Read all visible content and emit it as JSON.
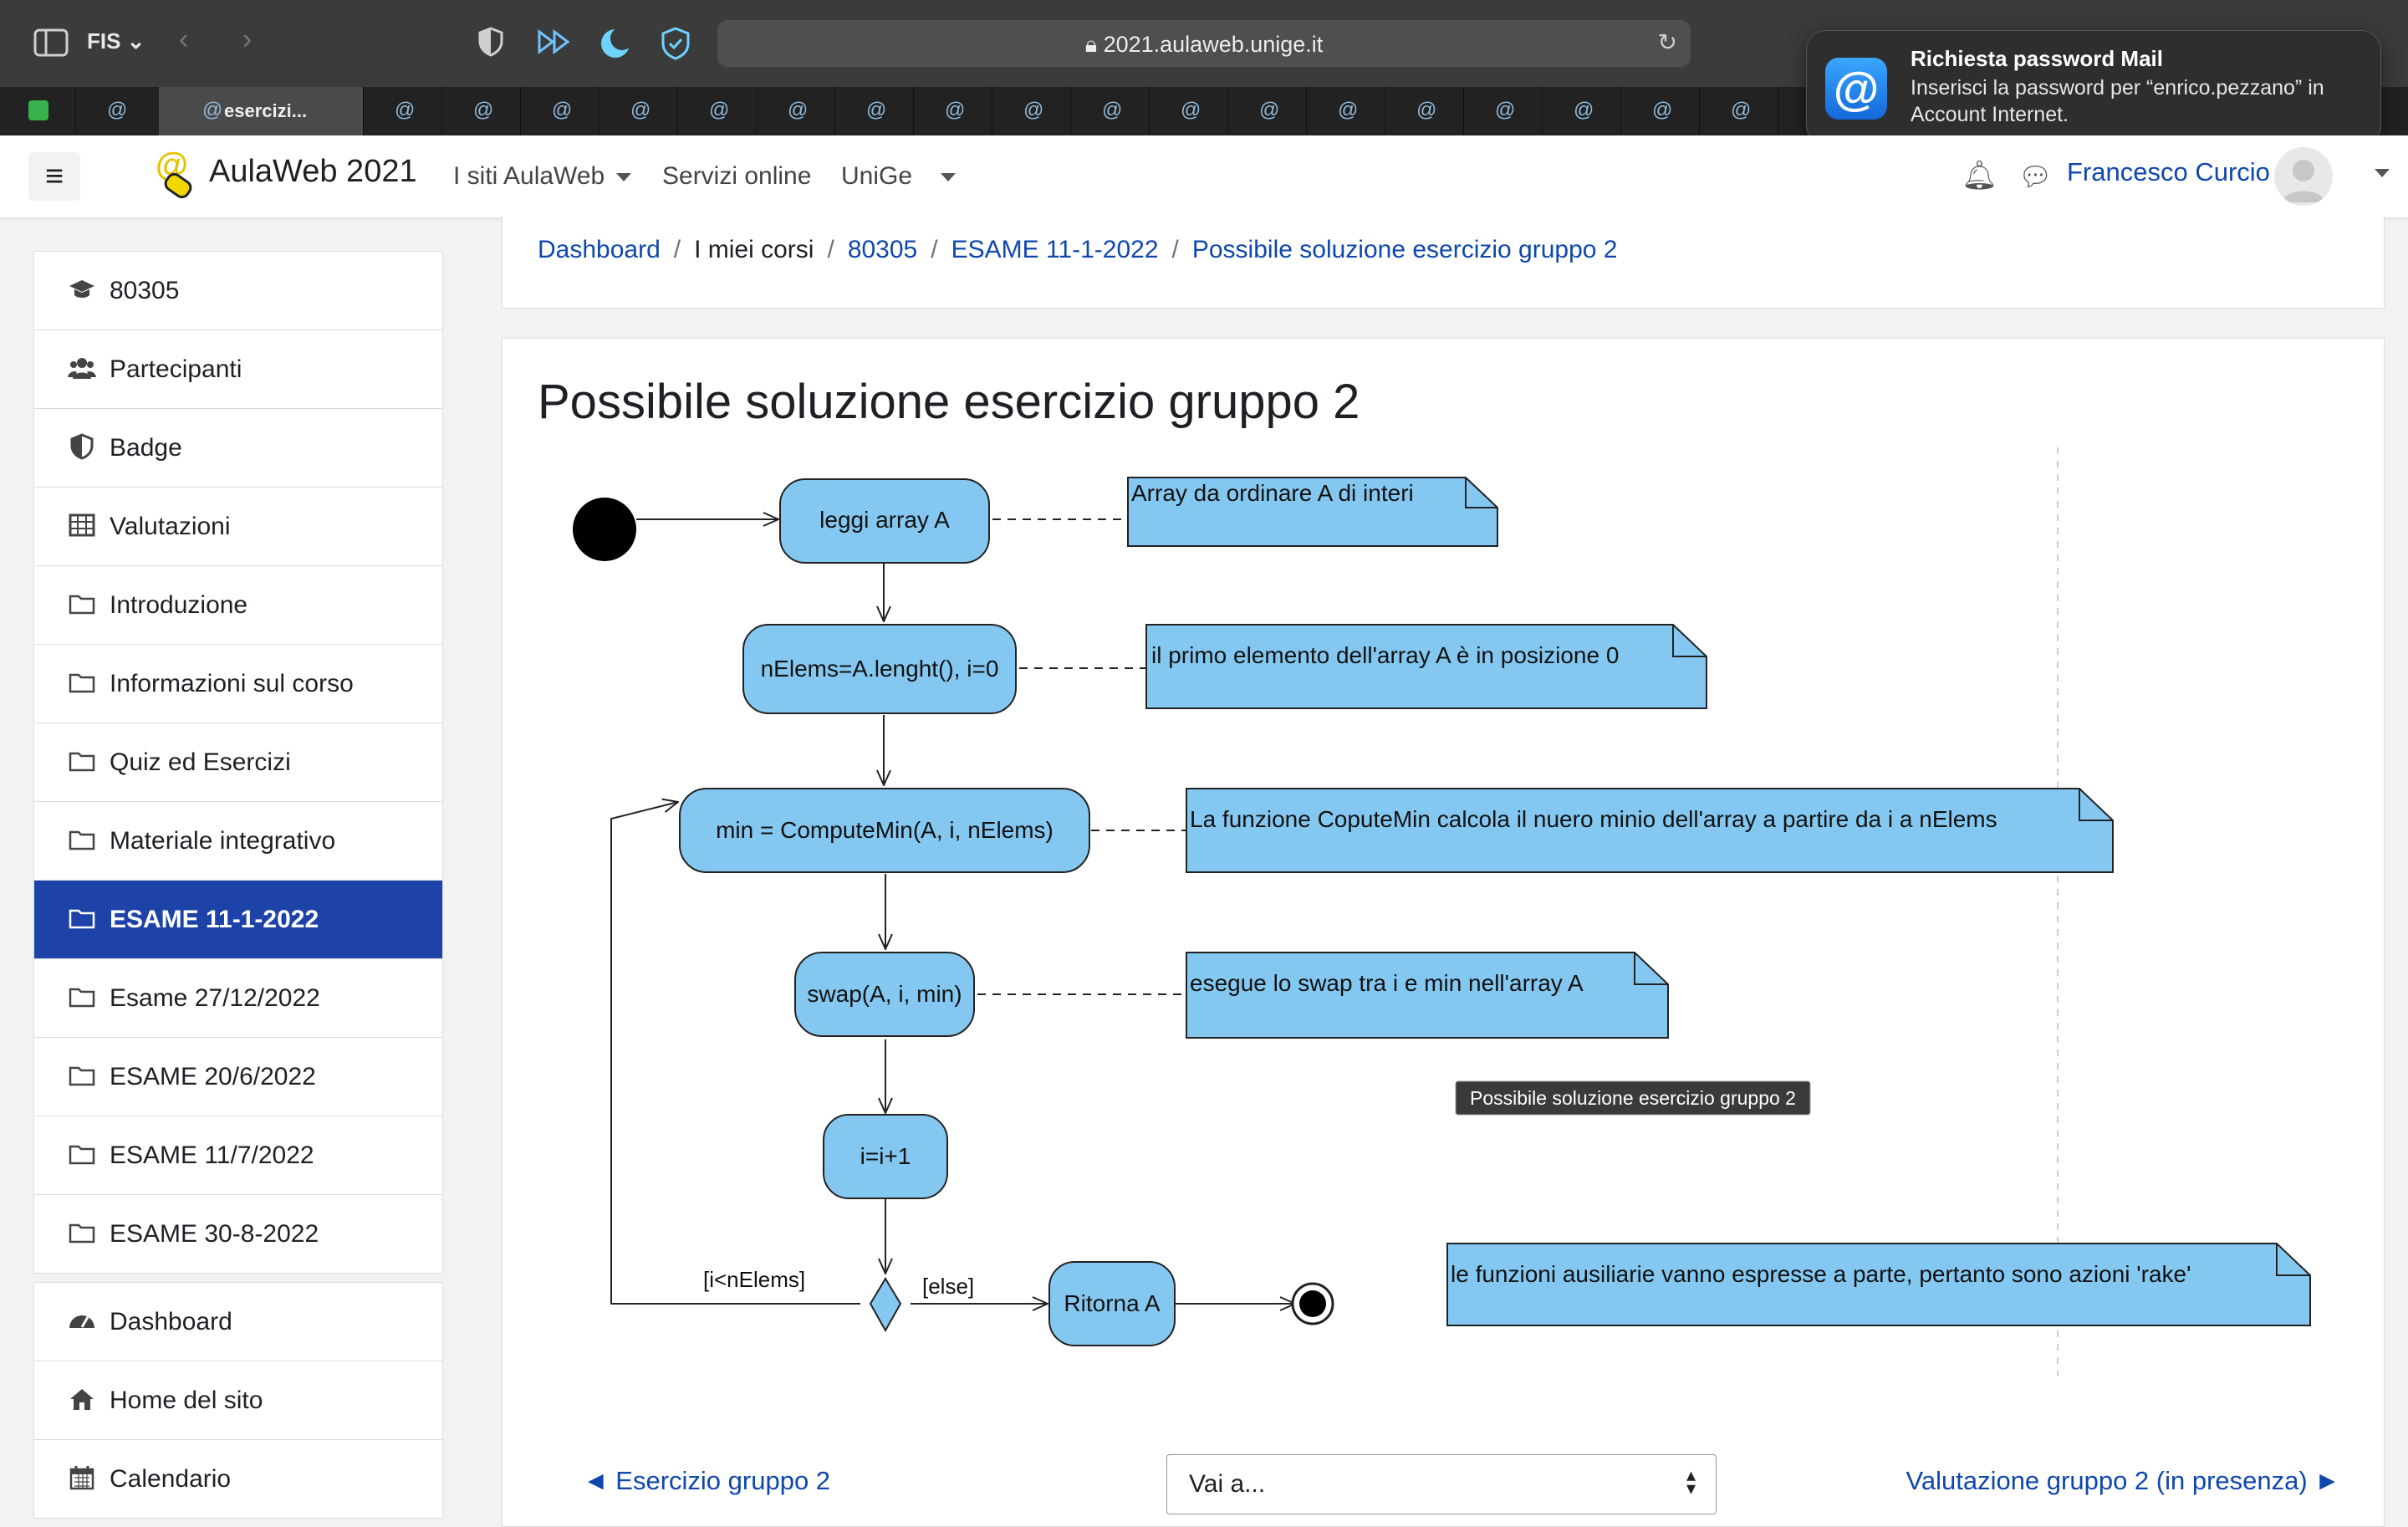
{
  "browser": {
    "profile": "FIS",
    "url": "2021.aulaweb.unige.it",
    "active_tab_title": "esercizi..."
  },
  "notification": {
    "title": "Richiesta password Mail",
    "body": "Inserisci la password per “enrico.pezzano” in Account Internet.",
    "icon": "at-sign-icon"
  },
  "navbar": {
    "site_name": "AulaWeb 2021",
    "menu": [
      "I siti AulaWeb",
      "Servizi online",
      "UniGe"
    ],
    "user_name": "Francesco Curcio"
  },
  "sidebar": {
    "course_items": [
      {
        "label": "80305",
        "icon": "graduation-cap-icon"
      },
      {
        "label": "Partecipanti",
        "icon": "users-icon"
      },
      {
        "label": "Badge",
        "icon": "shield-icon"
      },
      {
        "label": "Valutazioni",
        "icon": "table-icon"
      },
      {
        "label": "Introduzione",
        "icon": "folder-icon"
      },
      {
        "label": "Informazioni sul corso",
        "icon": "folder-icon"
      },
      {
        "label": "Quiz ed Esercizi",
        "icon": "folder-icon"
      },
      {
        "label": "Materiale integrativo",
        "icon": "folder-icon"
      },
      {
        "label": "ESAME 11-1-2022",
        "icon": "folder-icon",
        "active": true
      },
      {
        "label": "Esame 27/12/2022",
        "icon": "folder-icon"
      },
      {
        "label": "ESAME 20/6/2022",
        "icon": "folder-icon"
      },
      {
        "label": "ESAME 11/7/2022",
        "icon": "folder-icon"
      },
      {
        "label": "ESAME 30-8-2022",
        "icon": "folder-icon"
      }
    ],
    "site_items": [
      {
        "label": "Dashboard",
        "icon": "dashboard-icon"
      },
      {
        "label": "Home del sito",
        "icon": "home-icon"
      },
      {
        "label": "Calendario",
        "icon": "calendar-icon"
      }
    ]
  },
  "breadcrumb": [
    "Dashboard",
    "I miei corsi",
    "80305",
    "ESAME 11-1-2022",
    "Possibile soluzione esercizio gruppo 2"
  ],
  "page_title": "Possibile soluzione esercizio gruppo 2",
  "diagram": {
    "actions": {
      "read": "leggi array A",
      "init": "nElems=A.lenght(), i=0",
      "min": "min = ComputeMin(A, i, nElems)",
      "swap": "swap(A, i, min)",
      "inc": "i=i+1",
      "ret": "Ritorna A"
    },
    "notes": {
      "n1": "Array da ordinare A di interi",
      "n2": "il primo elemento dell'array A è in posizione 0",
      "n3": "La funzione CoputeMin calcola il nuero minio dell'array a partire da i a nElems",
      "n4": "esegue lo swap tra i e min nell'array A",
      "n5": "le funzioni ausiliarie vanno espresse a parte, pertanto sono azioni 'rake'"
    },
    "guards": {
      "loop": "[i<nElems]",
      "else": "[else]"
    },
    "tooltip": "Possibile soluzione esercizio gruppo 2",
    "colors": {
      "fill": "#84c8f1",
      "stroke": "#222222"
    }
  },
  "footer": {
    "prev_label": "◄ Esercizio gruppo 2",
    "jump_placeholder": "Vai a...",
    "next_label": "Valutazione gruppo 2 (in presenza) ►"
  }
}
